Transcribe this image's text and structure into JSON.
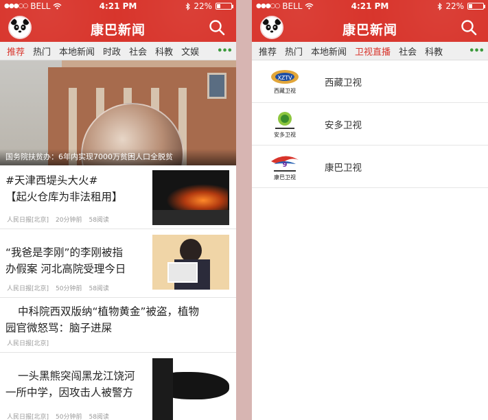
{
  "status": {
    "carrier": "BELL",
    "time": "4:21 PM",
    "battery": "22%",
    "battery_fraction": 0.22
  },
  "app": {
    "title": "康巴新闻"
  },
  "left": {
    "tabs": [
      "推荐",
      "热门",
      "本地新闻",
      "时政",
      "社会",
      "科教",
      "文娱"
    ],
    "active_tab": 0,
    "hero_caption": "国务院扶贫办：6年内实现7000万贫困人口全脱贫",
    "news": [
      {
        "title_line1": "#天津西堤头大火#",
        "title_line2": "【起火仓库为非法租用】",
        "source": "人民日报[北京]",
        "time": "20分钟前",
        "reads": "58阅读"
      },
      {
        "title_line1": "“我爸是李刚”的李刚被指",
        "title_line2": "办假案 河北高院受理今日",
        "source": "人民日报[北京]",
        "time": "50分钟前",
        "reads": "58阅读"
      },
      {
        "title_line1": "中科院西双版纳“植物黄金”被盗，植物",
        "title_line2": "园官微怒骂：脑子进屎",
        "source": "人民日报[北京]",
        "time": "50分钟前",
        "reads": "58阅读"
      },
      {
        "title_line1": "一头黑熊突闯黑龙江饶河",
        "title_line2": "一所中学，因攻击人被警方",
        "source": "人民日报[北京]",
        "time": "50分钟前",
        "reads": "58阅读"
      }
    ]
  },
  "right": {
    "tabs": [
      "推荐",
      "热门",
      "本地新闻",
      "卫视直播",
      "社会",
      "科教"
    ],
    "active_tab": 3,
    "channels": [
      {
        "name": "西藏卫视",
        "logo_text": "西藏卫视"
      },
      {
        "name": "安多卫视",
        "logo_text": "安多卫视"
      },
      {
        "name": "康巴卫视",
        "logo_text": "康巴卫视"
      }
    ]
  },
  "colors": {
    "brand": "#d8342b",
    "more_dots": "#3c9a3c",
    "backdrop": "#d7b5b2"
  },
  "icons": [
    "signal-dots-icon",
    "wifi-icon",
    "bluetooth-icon",
    "battery-icon",
    "panda-logo-icon",
    "search-icon",
    "more-tabs-icon"
  ]
}
